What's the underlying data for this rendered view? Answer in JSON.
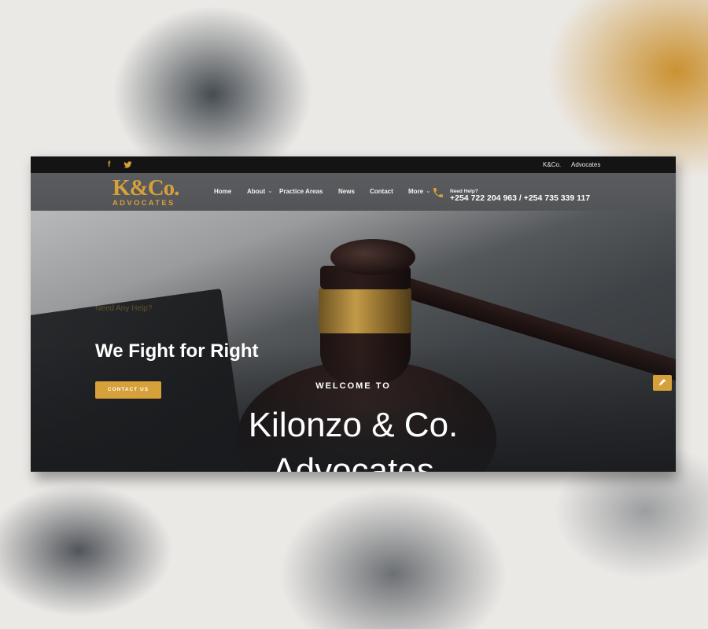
{
  "topbar": {
    "facebook_icon": "facebook-icon",
    "twitter_icon": "twitter-icon",
    "links": [
      "K&Co.",
      "Advocates"
    ]
  },
  "header": {
    "logo_main": "K&Co.",
    "logo_sub": "ADVOCATES",
    "nav": [
      "Home",
      "About",
      "Practice Areas",
      "News",
      "Contact",
      "More"
    ],
    "help_label": "Need Help?",
    "help_phone": "+254 722 204 963 / +254 735 339 117"
  },
  "hero": {
    "tagline": "Need Any Help?",
    "title": "We Fight for Right",
    "cta_label": "CONTACT US",
    "welcome": "WELCOME TO",
    "firm_line1": "Kilonzo & Co.",
    "firm_line2": "Advocates",
    "slide_count": 2,
    "active_slide": 1
  },
  "colors": {
    "accent": "#d6a03a",
    "topbar": "#141414",
    "header": "#58595c"
  }
}
